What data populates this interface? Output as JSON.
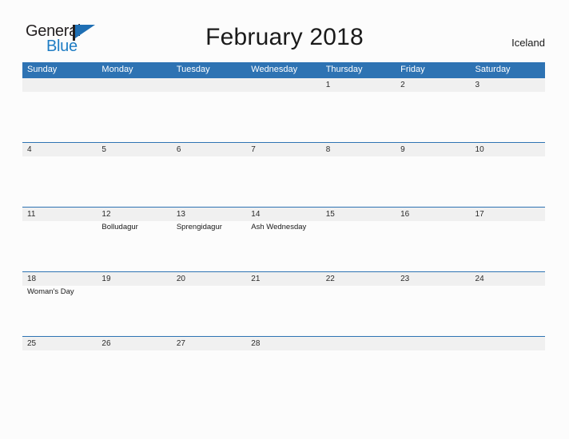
{
  "logo": {
    "word_primary": "General",
    "word_secondary": "Blue",
    "flag_icon": "flag-icon",
    "primary_color": "#231f20",
    "secondary_color": "#1f7dc4"
  },
  "header": {
    "title": "February 2018",
    "region": "Iceland"
  },
  "colors": {
    "header_blue": "#2e73b3",
    "daynum_band": "#f0f0f0",
    "page_background": "#fcfcfc",
    "text": "#1a1a1a"
  },
  "calendar": {
    "month": "February",
    "year": "2018",
    "weekday_headers": [
      "Sunday",
      "Monday",
      "Tuesday",
      "Wednesday",
      "Thursday",
      "Friday",
      "Saturday"
    ],
    "weeks": [
      {
        "days": [
          {
            "number": "",
            "event": ""
          },
          {
            "number": "",
            "event": ""
          },
          {
            "number": "",
            "event": ""
          },
          {
            "number": "",
            "event": ""
          },
          {
            "number": "1",
            "event": ""
          },
          {
            "number": "2",
            "event": ""
          },
          {
            "number": "3",
            "event": ""
          }
        ]
      },
      {
        "days": [
          {
            "number": "4",
            "event": ""
          },
          {
            "number": "5",
            "event": ""
          },
          {
            "number": "6",
            "event": ""
          },
          {
            "number": "7",
            "event": ""
          },
          {
            "number": "8",
            "event": ""
          },
          {
            "number": "9",
            "event": ""
          },
          {
            "number": "10",
            "event": ""
          }
        ]
      },
      {
        "days": [
          {
            "number": "11",
            "event": ""
          },
          {
            "number": "12",
            "event": "Bolludagur"
          },
          {
            "number": "13",
            "event": "Sprengidagur"
          },
          {
            "number": "14",
            "event": "Ash Wednesday"
          },
          {
            "number": "15",
            "event": ""
          },
          {
            "number": "16",
            "event": ""
          },
          {
            "number": "17",
            "event": ""
          }
        ]
      },
      {
        "days": [
          {
            "number": "18",
            "event": "Woman's Day"
          },
          {
            "number": "19",
            "event": ""
          },
          {
            "number": "20",
            "event": ""
          },
          {
            "number": "21",
            "event": ""
          },
          {
            "number": "22",
            "event": ""
          },
          {
            "number": "23",
            "event": ""
          },
          {
            "number": "24",
            "event": ""
          }
        ]
      },
      {
        "days": [
          {
            "number": "25",
            "event": ""
          },
          {
            "number": "26",
            "event": ""
          },
          {
            "number": "27",
            "event": ""
          },
          {
            "number": "28",
            "event": ""
          },
          {
            "number": "",
            "event": ""
          },
          {
            "number": "",
            "event": ""
          },
          {
            "number": "",
            "event": ""
          }
        ]
      }
    ]
  }
}
